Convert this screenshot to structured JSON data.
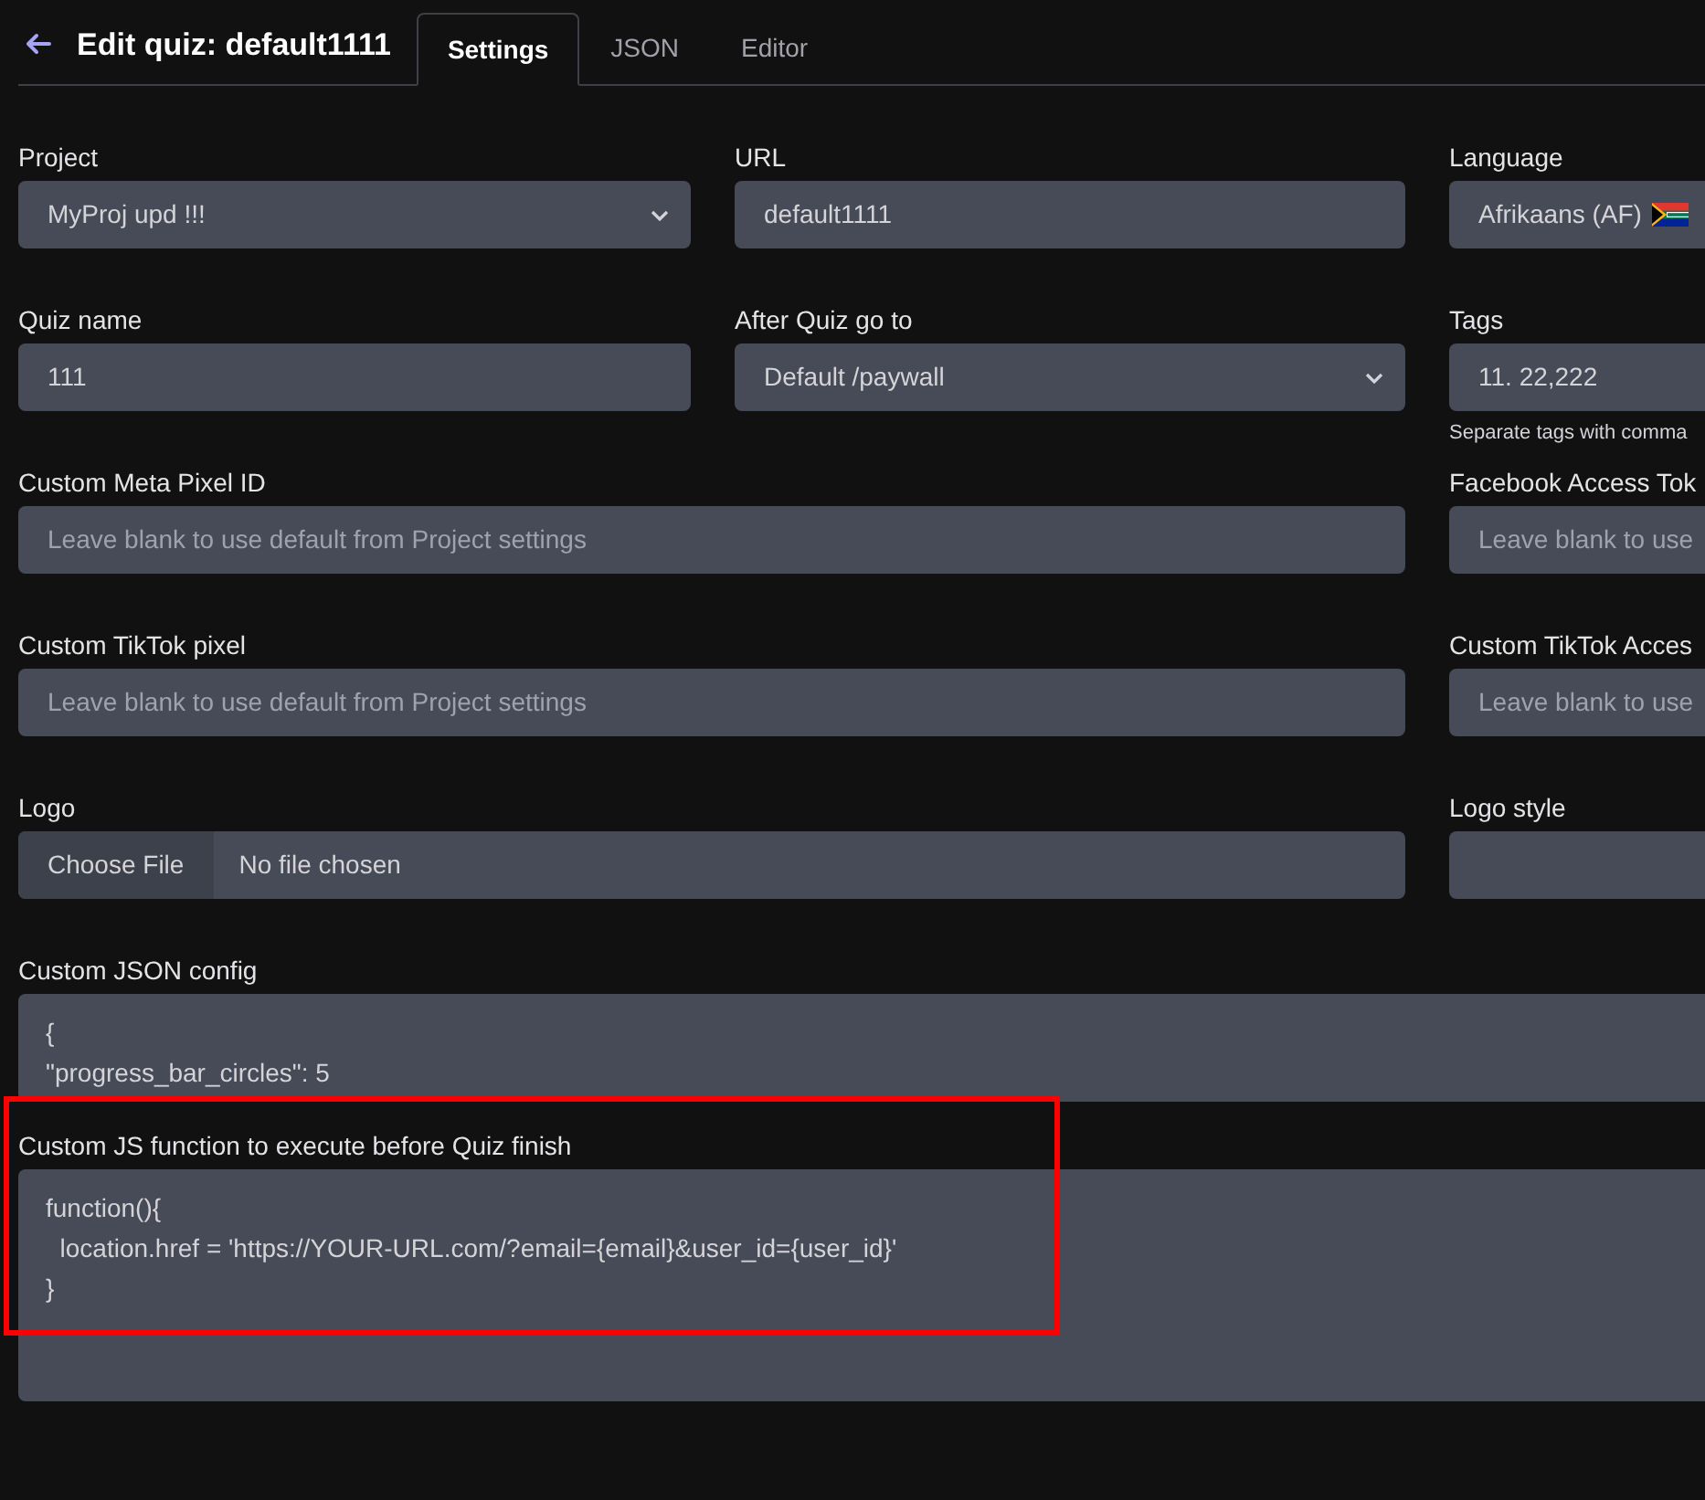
{
  "header": {
    "title": "Edit quiz: default1111",
    "tabs": [
      {
        "label": "Settings",
        "selected": true
      },
      {
        "label": "JSON",
        "selected": false
      },
      {
        "label": "Editor",
        "selected": false
      }
    ]
  },
  "rows": [
    [
      {
        "label": "Project",
        "kind": "select",
        "value": "MyProj upd !!!"
      },
      {
        "label": "URL",
        "kind": "text",
        "value": "default1111"
      },
      {
        "label": "Language",
        "kind": "flag",
        "value": "Afrikaans (AF)"
      }
    ],
    [
      {
        "label": "Quiz name",
        "kind": "text",
        "value": "111"
      },
      {
        "label": "After Quiz go to",
        "kind": "select",
        "value": "Default /paywall"
      },
      {
        "label": "Tags",
        "kind": "text",
        "value": "11. 22,222",
        "help": "Separate tags with comma"
      }
    ],
    [
      {
        "label": "Custom Meta Pixel ID",
        "kind": "text",
        "placeholder": "Leave blank to use default from Project settings"
      },
      {
        "label": "Facebook Access Tok",
        "kind": "text",
        "placeholder": "Leave blank to use"
      }
    ],
    [
      {
        "label": "Custom TikTok pixel",
        "kind": "text",
        "placeholder": "Leave blank to use default from Project settings"
      },
      {
        "label": "Custom TikTok Acces",
        "kind": "text",
        "placeholder": "Leave blank to use"
      }
    ],
    [
      {
        "label": "Logo",
        "kind": "file",
        "button": "Choose File",
        "value": "No file chosen"
      },
      {
        "label": "Logo style",
        "kind": "text"
      }
    ]
  ],
  "code_fields": [
    {
      "label": "Custom JSON config",
      "lines": [
        "{",
        "\"progress_bar_circles\": 5"
      ],
      "highlighted": false
    },
    {
      "label": "Custom JS function to execute before Quiz finish",
      "lines": [
        "function(){",
        "  location.href = 'https://YOUR-URL.com/?email={email}&user_id={user_id}'",
        "}"
      ],
      "highlighted": true
    }
  ]
}
